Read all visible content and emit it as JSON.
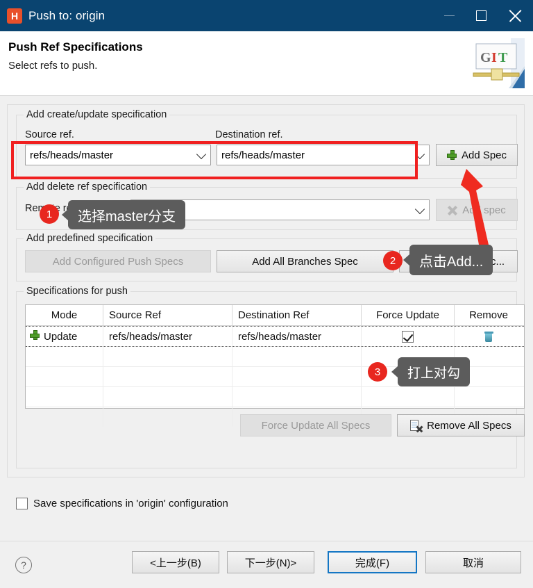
{
  "window": {
    "title": "Push to: origin",
    "app_icon": "H",
    "controls": {
      "minimize": "minimize-icon",
      "maximize": "maximize-icon",
      "close": "close-icon"
    },
    "titlebar_color": "#0a4470"
  },
  "header": {
    "title": "Push Ref Specifications",
    "subtitle": "Select refs to push.",
    "banner_text": "GIT"
  },
  "create_update_group": {
    "legend": "Add create/update specification",
    "source_label": "Source ref.",
    "destination_label": "Destination ref.",
    "source_value": "refs/heads/master",
    "destination_value": "refs/heads/master",
    "add_spec_button": "Add Spec"
  },
  "delete_group": {
    "legend": "Add delete ref specification",
    "remote_label": "Remote ref to delete:",
    "remote_value": "",
    "add_spec_button": "Add spec"
  },
  "predefined_group": {
    "legend": "Add predefined specification",
    "add_configured": "Add Configured Push Specs",
    "add_all_branches": "Add All Branches Spec",
    "add_all_tags": "Add All Tags Spec..."
  },
  "specs_group": {
    "legend": "Specifications for push",
    "columns": [
      "Mode",
      "Source Ref",
      "Destination Ref",
      "Force Update",
      "Remove"
    ],
    "rows": [
      {
        "mode": "Update",
        "source_ref": "refs/heads/master",
        "destination_ref": "refs/heads/master",
        "force_update": true,
        "remove_icon": "trash-icon"
      }
    ],
    "empty_row_count": 4,
    "force_update_all": "Force Update All Specs",
    "remove_all": "Remove All Specs"
  },
  "save_option": {
    "label": "Save specifications in 'origin' configuration",
    "checked": false
  },
  "footer": {
    "help": "?",
    "back": "<上一步(B)",
    "next": "下一步(N)>",
    "finish": "完成(F)",
    "cancel": "取消"
  },
  "annotations": {
    "badge1": "1",
    "tip1": "选择master分支",
    "badge2": "2",
    "tip2": "点击Add...",
    "badge3": "3",
    "tip3": "打上对勾",
    "highlight_color": "#f02020"
  }
}
